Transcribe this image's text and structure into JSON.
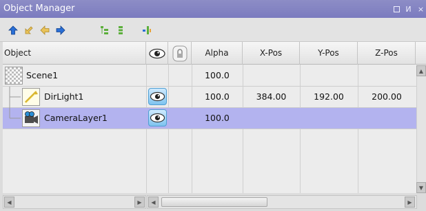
{
  "window": {
    "title": "Object Manager",
    "restore_icon": "restore-icon",
    "pin_icon": "pin-icon",
    "close_icon": "close-icon",
    "pin_glyph": "И",
    "close_glyph": "×"
  },
  "toolbar": {
    "tools": [
      "arrow-up-icon",
      "arrow-down-left-icon",
      "arrow-left-icon",
      "arrow-right-icon",
      "expand-tree-icon",
      "collapse-tree-icon",
      "sort-icon"
    ]
  },
  "grid": {
    "columns": {
      "object": "Object",
      "visibility_icon": "eye-icon",
      "lock_icon": "lock-icon",
      "alpha": "Alpha",
      "xpos": "X-Pos",
      "ypos": "Y-Pos",
      "zpos": "Z-Pos"
    },
    "rows": [
      {
        "name": "Scene1",
        "alpha": "100.0",
        "xpos": "",
        "ypos": "",
        "zpos": "",
        "thumb": "scene-thumbnail",
        "visible_toggle": false,
        "selected": false
      },
      {
        "name": "DirLight1",
        "alpha": "100.0",
        "xpos": "384.00",
        "ypos": "192.00",
        "zpos": "200.00",
        "thumb": "directional-light-icon",
        "visible_toggle": true,
        "selected": false
      },
      {
        "name": "CameraLayer1",
        "alpha": "100.0",
        "xpos": "",
        "ypos": "",
        "zpos": "",
        "thumb": "camera-layer-icon",
        "visible_toggle": true,
        "selected": true
      }
    ]
  },
  "colors": {
    "titlebar": "#7b7bbf",
    "selection": "#b3b3ef",
    "eye_toggle": "#7ec3ef"
  }
}
